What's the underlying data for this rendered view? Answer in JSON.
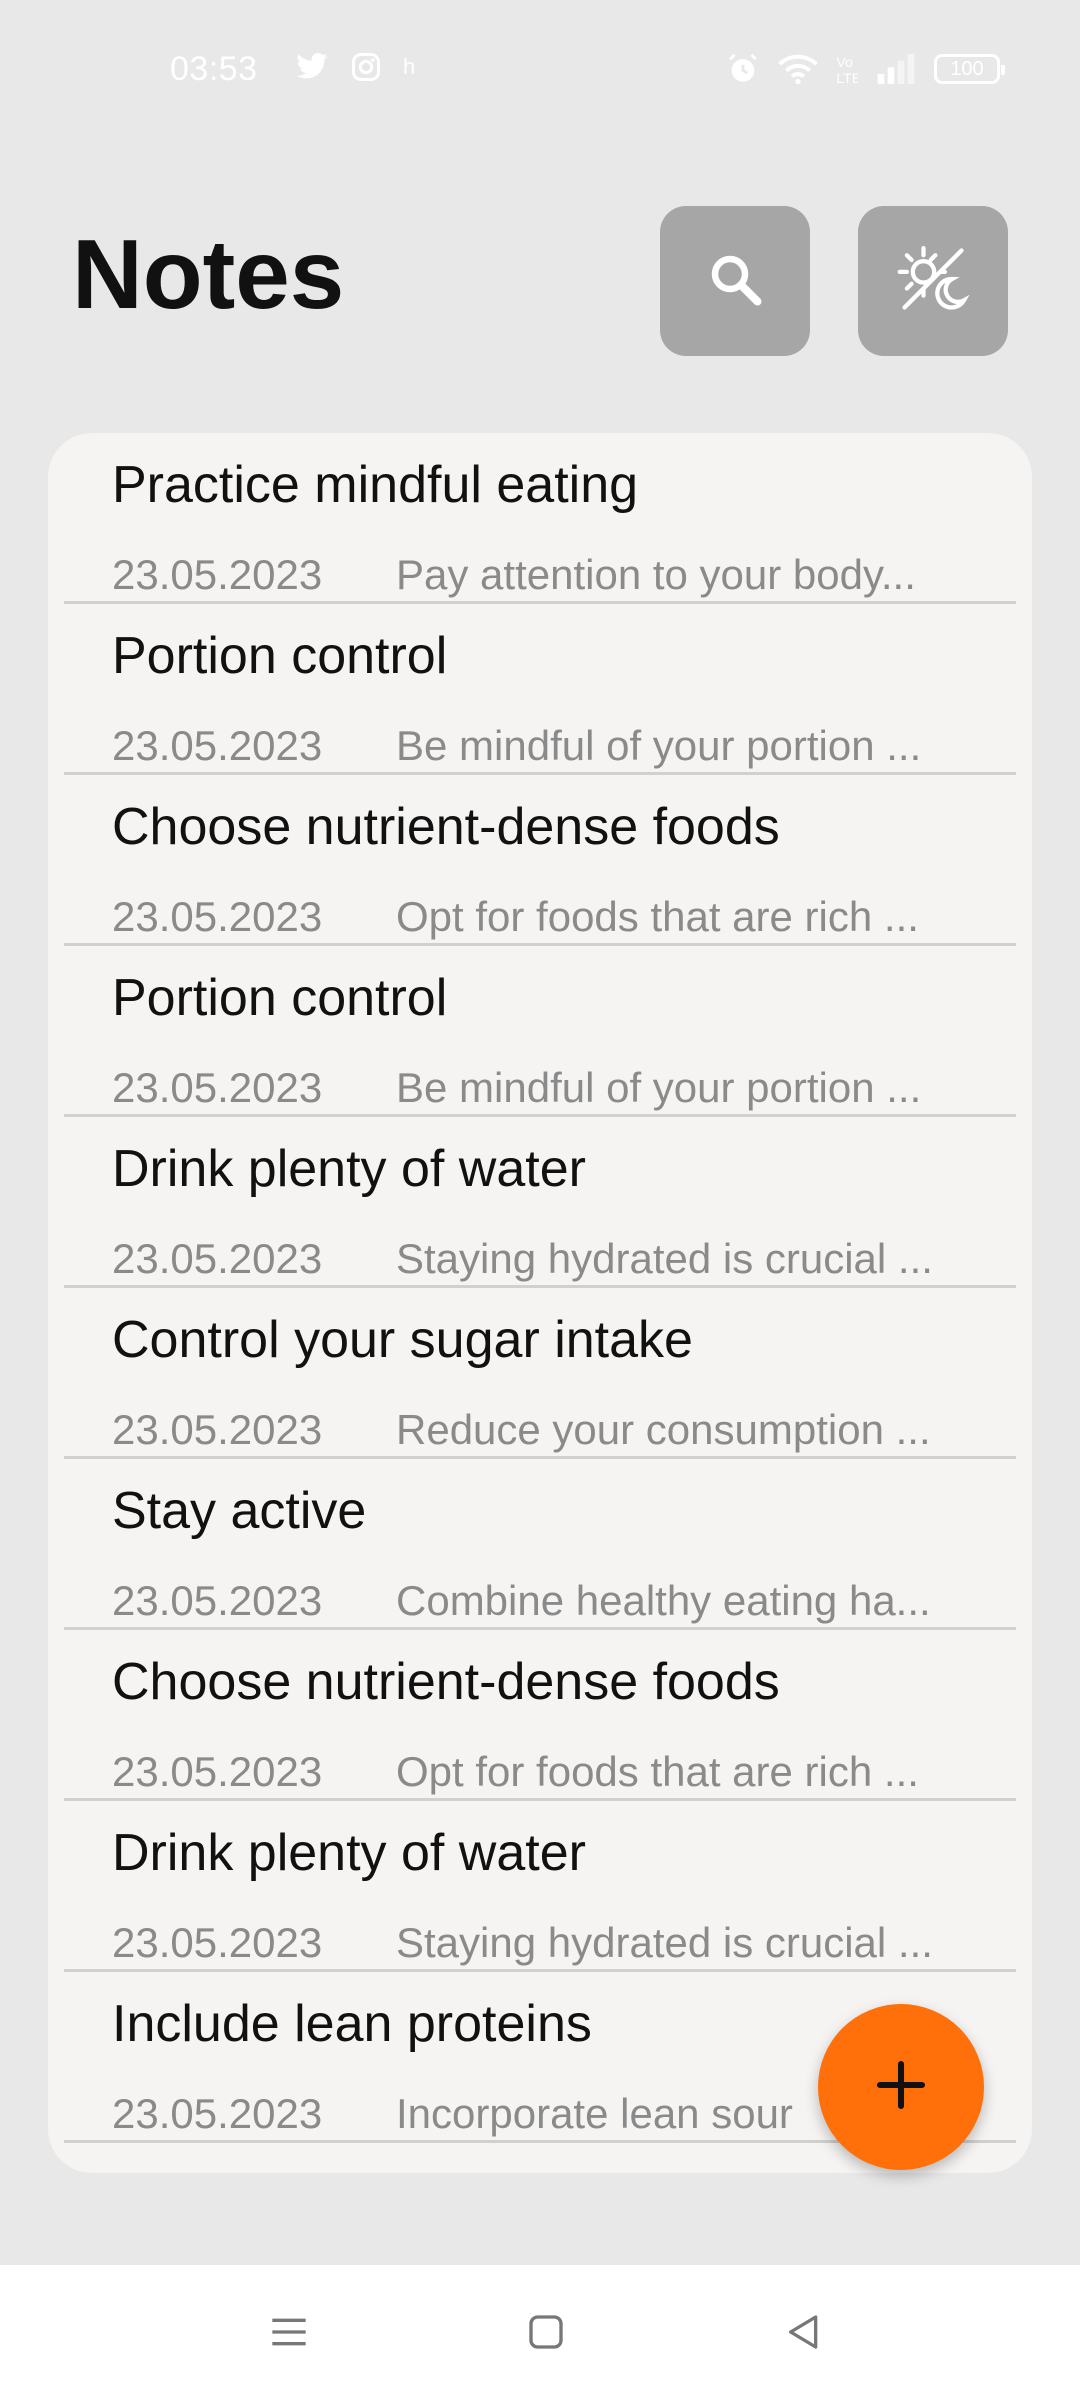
{
  "status_bar": {
    "time": "03:53",
    "left_icons": [
      "twitter-icon",
      "instagram-icon",
      "h-icon"
    ],
    "h_glyph": "h",
    "right_icons": [
      "alarm-icon",
      "wifi-icon",
      "volte-icon",
      "signal-icon",
      "battery-icon"
    ],
    "battery": "100"
  },
  "header": {
    "title": "Notes",
    "search_icon": "search-icon",
    "theme_icon": "day-night-icon"
  },
  "notes": [
    {
      "title": "Practice mindful eating",
      "date": "23.05.2023",
      "preview": "Pay attention to your body..."
    },
    {
      "title": "Portion control",
      "date": "23.05.2023",
      "preview": "Be mindful of your portion ..."
    },
    {
      "title": "Choose nutrient-dense foods",
      "date": "23.05.2023",
      "preview": "Opt for foods that are rich ..."
    },
    {
      "title": "Portion control",
      "date": "23.05.2023",
      "preview": "Be mindful of your portion ..."
    },
    {
      "title": "Drink plenty of water",
      "date": "23.05.2023",
      "preview": "Staying hydrated is crucial ..."
    },
    {
      "title": "Control your sugar intake",
      "date": "23.05.2023",
      "preview": "Reduce your consumption ..."
    },
    {
      "title": "Stay active",
      "date": "23.05.2023",
      "preview": "Combine healthy eating ha..."
    },
    {
      "title": "Choose nutrient-dense foods",
      "date": "23.05.2023",
      "preview": "Opt for foods that are rich ..."
    },
    {
      "title": "Drink plenty of water",
      "date": "23.05.2023",
      "preview": "Staying hydrated is crucial ..."
    },
    {
      "title": "Include lean proteins",
      "date": "23.05.2023",
      "preview": "Incorporate lean sour"
    }
  ],
  "fab": {
    "icon": "plus-icon"
  },
  "nav": {
    "menu_icon": "menu-icon",
    "home_icon": "home-icon",
    "back_icon": "back-icon"
  },
  "colors": {
    "accent": "#ff6f0a",
    "header_button": "#a6a6a6",
    "card": "#f5f4f2",
    "background": "#e8e8e8",
    "secondary_text": "#8a8a8a"
  }
}
